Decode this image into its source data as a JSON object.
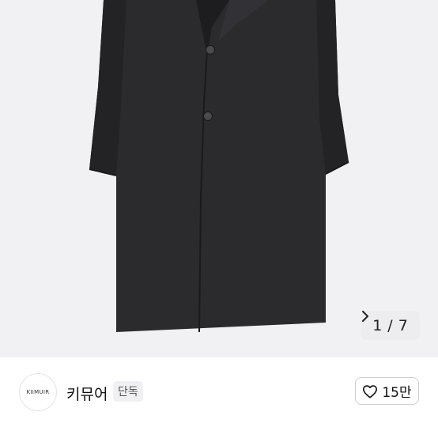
{
  "gallery": {
    "image_alt": "black wool long coat",
    "current": "1",
    "total": "7",
    "separator": "/",
    "next_icon": "chevron-right-icon"
  },
  "brand": {
    "logo_text": "KIIMUIR",
    "name": "키뮤어",
    "badge": "단독"
  },
  "like": {
    "icon": "heart-outline-icon",
    "count": "15만"
  }
}
